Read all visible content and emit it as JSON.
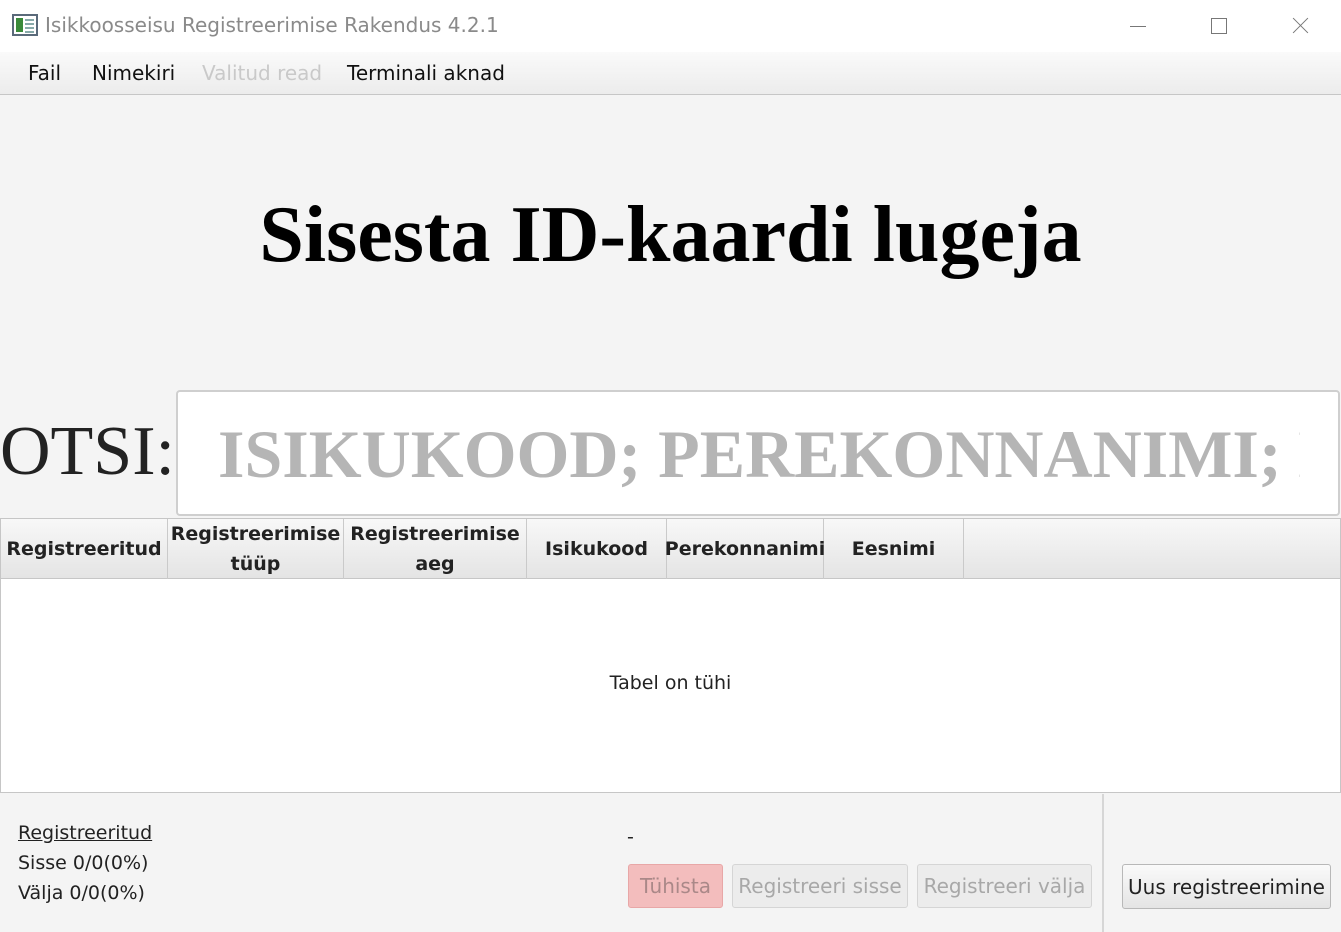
{
  "window": {
    "title": "Isikkoosseisu Registreerimise Rakendus 4.2.1"
  },
  "menu": {
    "items": [
      {
        "label": "Fail",
        "enabled": true
      },
      {
        "label": "Nimekiri",
        "enabled": true
      },
      {
        "label": "Valitud read",
        "enabled": false
      },
      {
        "label": "Terminali aknad",
        "enabled": true
      }
    ]
  },
  "main": {
    "heading": "Sisesta ID-kaardi lugeja",
    "search": {
      "label": "OTSI:",
      "placeholder": "ISIKUKOOD; PEREKONNANIMI; EESNIMI",
      "value": ""
    }
  },
  "table": {
    "columns": [
      {
        "line1": "Registreeritud",
        "line2": ""
      },
      {
        "line1": "Registreerimise",
        "line2": "tüüp"
      },
      {
        "line1": "Registreerimise",
        "line2": "aeg"
      },
      {
        "line1": "Isikukood",
        "line2": ""
      },
      {
        "line1": "Perekonnanimi",
        "line2": ""
      },
      {
        "line1": "Eesnimi",
        "line2": ""
      }
    ],
    "rows": [],
    "empty_message": "Tabel on tühi"
  },
  "stats": {
    "title": "Registreeritud",
    "in": "Sisse  0/0(0%)",
    "out": "Välja  0/0(0%)"
  },
  "selection_status": "-",
  "buttons": {
    "cancel": {
      "label": "Tühista",
      "enabled": false
    },
    "register_in": {
      "label": "Registreeri sisse",
      "enabled": false
    },
    "register_out": {
      "label": "Registreeri välja",
      "enabled": false
    },
    "new_registration": {
      "label": "Uus registreerimine",
      "enabled": true
    }
  },
  "colors": {
    "cancel_bg": "#f3bdbd",
    "disabled_text": "#a8a8a8",
    "placeholder": "#b5b5b5"
  }
}
